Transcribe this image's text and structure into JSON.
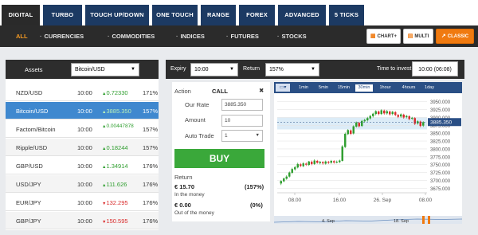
{
  "tabs": [
    "DIGITAL",
    "TURBO",
    "TOUCH UP/DOWN",
    "ONE TOUCH",
    "RANGE",
    "FOREX",
    "ADVANCED",
    "5 TICKS"
  ],
  "filters": [
    "ALL",
    "CURRENCIES",
    "COMMODITIES",
    "INDICES",
    "FUTURES",
    "STOCKS"
  ],
  "view_buttons": [
    "CHART+",
    "MULTI",
    "CLASSIC"
  ],
  "assets_panel": {
    "label": "Assets",
    "selected_asset": "Bitcoin/USD",
    "rows": [
      {
        "name": "NZD/USD",
        "time": "10:00",
        "price": "0.72330",
        "dir": "up",
        "pct": "171%"
      },
      {
        "name": "Bitcoin/USD",
        "time": "10:00",
        "price": "3885.350",
        "dir": "up",
        "pct": "157%"
      },
      {
        "name": "Factom/Bitcoin",
        "time": "10:00",
        "price": "0.00447878",
        "dir": "up",
        "pct": "157%"
      },
      {
        "name": "Ripple/USD",
        "time": "10:00",
        "price": "0.18244",
        "dir": "up",
        "pct": "157%"
      },
      {
        "name": "GBP/USD",
        "time": "10:00",
        "price": "1.34914",
        "dir": "up",
        "pct": "176%"
      },
      {
        "name": "USD/JPY",
        "time": "10:00",
        "price": "111.626",
        "dir": "up",
        "pct": "176%"
      },
      {
        "name": "EUR/JPY",
        "time": "10:00",
        "price": "132.295",
        "dir": "down",
        "pct": "176%"
      },
      {
        "name": "GBP/JPY",
        "time": "10:00",
        "price": "150.595",
        "dir": "down",
        "pct": "176%"
      }
    ]
  },
  "trade_header": {
    "expiry_label": "Expiry",
    "expiry_value": "10:00",
    "return_label": "Return",
    "return_value": "157%",
    "time_to_invest_label": "Time to invest",
    "time_to_invest_value": "10:00 (06:08)"
  },
  "form": {
    "action_label": "Action",
    "action_value": "CALL",
    "close_glyph": "✖",
    "our_rate_label": "Our Rate",
    "our_rate_value": "3885.350",
    "amount_label": "Amount",
    "amount_value": "10",
    "auto_trade_label": "Auto Trade",
    "auto_trade_value": "1",
    "buy_label": "BUY",
    "return_label": "Return",
    "in_money_value": "€ 15.70",
    "in_money_pct": "(157%)",
    "in_money_label": "In the money",
    "out_money_value": "€ 0.00",
    "out_money_pct": "(0%)",
    "out_money_label": "Out of the money"
  },
  "chart_toolbar": {
    "tool_icon": "chart-tools-icon",
    "intervals": [
      "1min",
      "5min",
      "15min",
      "30min",
      "1hour",
      "4hours",
      "1day"
    ],
    "active_interval": "30min"
  },
  "colors": {
    "nav_blue": "#1c3a63",
    "accent_orange": "#f07a10",
    "up_green": "#2f9e2f",
    "down_red": "#d92b2b",
    "selected_row": "#3f88cf",
    "buy_green": "#3aa83a"
  },
  "chart_data": {
    "type": "candlestick",
    "yticks": [
      "3950.000",
      "3925.000",
      "3900.000",
      "3875.000",
      "3850.000",
      "3825.000",
      "3800.000",
      "3775.000",
      "3750.000",
      "3725.000",
      "3700.000",
      "3675.000"
    ],
    "ylim": [
      3663,
      3962
    ],
    "current_price": "3885.350",
    "xticks": [
      "08.00",
      "16.00",
      "26. Sep",
      "08.00"
    ],
    "navigator_labels": [
      "4. Sep",
      "18. Sep"
    ],
    "candles": [
      [
        3690,
        3698,
        3685,
        3700
      ],
      [
        3697,
        3706,
        3694,
        3709
      ],
      [
        3705,
        3712,
        3702,
        3716
      ],
      [
        3712,
        3725,
        3709,
        3728
      ],
      [
        3724,
        3736,
        3720,
        3740
      ],
      [
        3735,
        3742,
        3731,
        3746
      ],
      [
        3741,
        3752,
        3738,
        3756
      ],
      [
        3751,
        3746,
        3742,
        3755
      ],
      [
        3745,
        3754,
        3742,
        3758
      ],
      [
        3753,
        3750,
        3746,
        3757
      ],
      [
        3749,
        3760,
        3746,
        3762
      ],
      [
        3759,
        3752,
        3748,
        3763
      ],
      [
        3752,
        3763,
        3749,
        3767
      ],
      [
        3762,
        3756,
        3753,
        3765
      ],
      [
        3755,
        3759,
        3751,
        3762
      ],
      [
        3758,
        3754,
        3750,
        3761
      ],
      [
        3753,
        3760,
        3750,
        3763
      ],
      [
        3759,
        3756,
        3752,
        3762
      ],
      [
        3756,
        3762,
        3753,
        3765
      ],
      [
        3761,
        3757,
        3753,
        3764
      ],
      [
        3757,
        3759,
        3754,
        3763
      ],
      [
        3758,
        3763,
        3755,
        3766
      ],
      [
        3762,
        3808,
        3760,
        3812
      ],
      [
        3806,
        3848,
        3803,
        3852
      ],
      [
        3847,
        3860,
        3844,
        3863
      ],
      [
        3859,
        3848,
        3844,
        3862
      ],
      [
        3849,
        3872,
        3846,
        3875
      ],
      [
        3871,
        3884,
        3868,
        3887
      ],
      [
        3883,
        3872,
        3868,
        3886
      ],
      [
        3873,
        3889,
        3870,
        3892
      ],
      [
        3888,
        3892,
        3884,
        3896
      ],
      [
        3891,
        3898,
        3887,
        3902
      ],
      [
        3897,
        3905,
        3893,
        3908
      ],
      [
        3904,
        3912,
        3900,
        3915
      ],
      [
        3911,
        3920,
        3907,
        3923
      ],
      [
        3919,
        3911,
        3907,
        3922
      ],
      [
        3911,
        3923,
        3908,
        3926
      ],
      [
        3922,
        3913,
        3909,
        3925
      ],
      [
        3913,
        3920,
        3909,
        3924
      ],
      [
        3919,
        3910,
        3906,
        3922
      ],
      [
        3911,
        3918,
        3907,
        3921
      ],
      [
        3917,
        3908,
        3904,
        3920
      ],
      [
        3908,
        3902,
        3898,
        3911
      ],
      [
        3903,
        3910,
        3899,
        3913
      ],
      [
        3909,
        3900,
        3896,
        3912
      ],
      [
        3901,
        3905,
        3897,
        3908
      ],
      [
        3904,
        3895,
        3891,
        3907
      ],
      [
        3896,
        3899,
        3892,
        3902
      ],
      [
        3898,
        3880,
        3876,
        3901
      ],
      [
        3881,
        3888,
        3877,
        3891
      ],
      [
        3887,
        3873,
        3869,
        3890
      ],
      [
        3874,
        3885,
        3870,
        3888
      ]
    ]
  }
}
